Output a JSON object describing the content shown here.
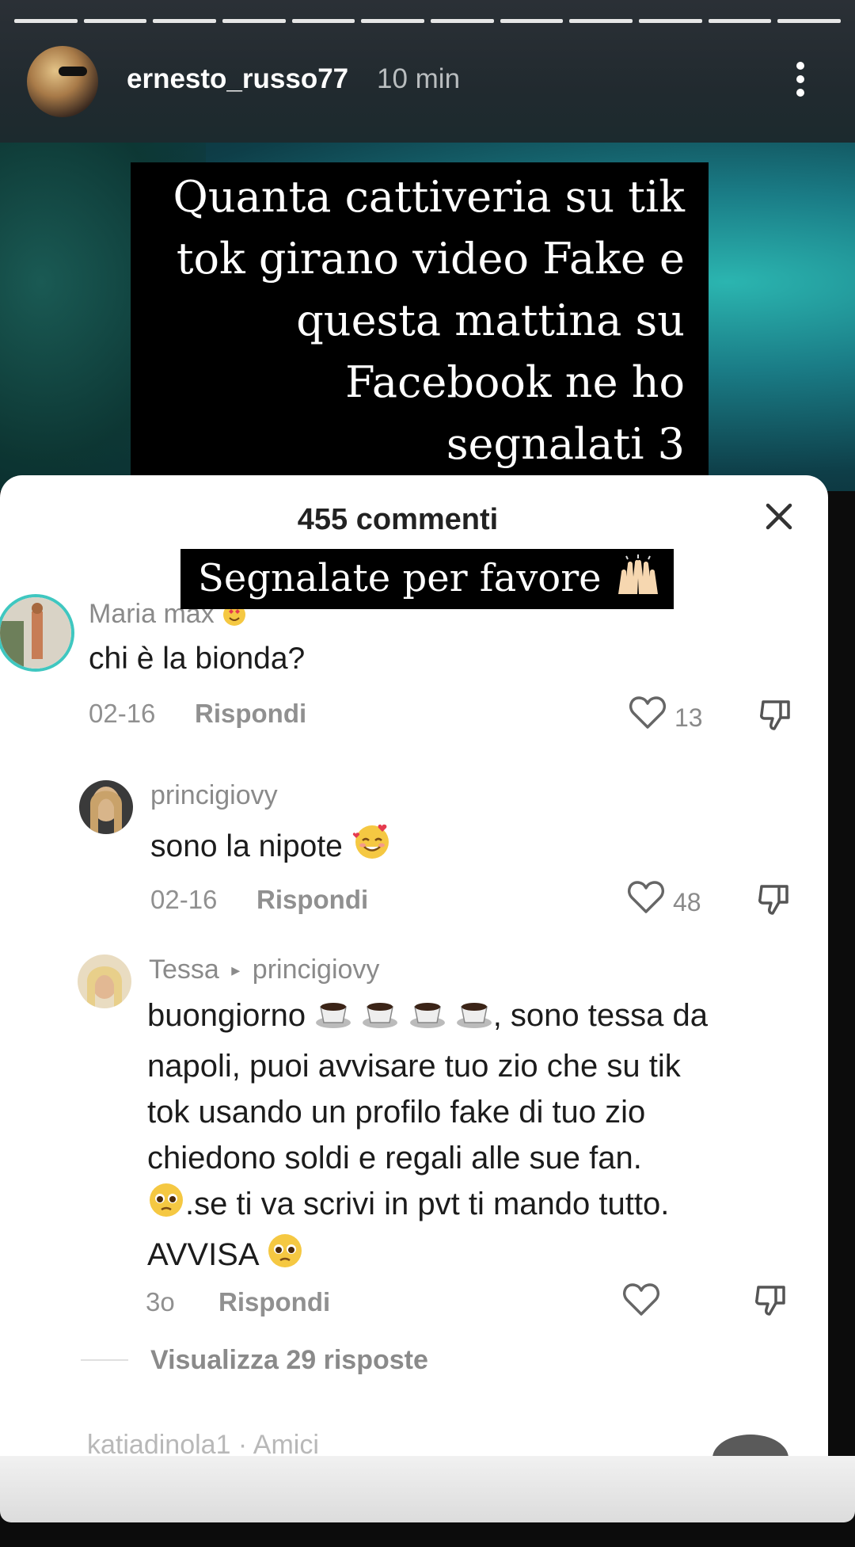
{
  "story": {
    "segments": 12,
    "username": "ernesto_russo77",
    "time": "10 min",
    "caption_lines": [
      "Quanta cattiveria su tik",
      "tok girano video  Fake e",
      "questa mattina su",
      "Facebook ne ho",
      "segnalati 3"
    ],
    "banner": "Segnalate per favore"
  },
  "sheet": {
    "title": "455 commenti",
    "comments": [
      {
        "user": "Maria max",
        "text": "chi è la bionda?",
        "date": "02-16",
        "reply": "Rispondi",
        "likes": "13"
      },
      {
        "user": "princigiovy",
        "text": "sono la nipote",
        "date": "02-16",
        "reply": "Rispondi",
        "likes": "48"
      },
      {
        "user": "Tessa",
        "reply_to": "princigiovy",
        "text_lines": [
          "buongiorno",
          ", sono tessa da",
          "napoli, puoi avvisare tuo zio che su tik",
          "tok usando un profilo fake di tuo zio",
          "chiedono soldi e regali alle sue fan.",
          ".se ti va scrivi in pvt ti mando tutto.",
          "AVVISA"
        ],
        "date": "3o",
        "reply": "Rispondi"
      }
    ],
    "view_replies": "Visualizza 29 risposte",
    "cut_off_text": "katiadinola1 · Amici"
  },
  "colors": {
    "accent_ring": "#3fc7c0",
    "caption_bg": "#000000",
    "sheet_bg": "#ffffff"
  }
}
